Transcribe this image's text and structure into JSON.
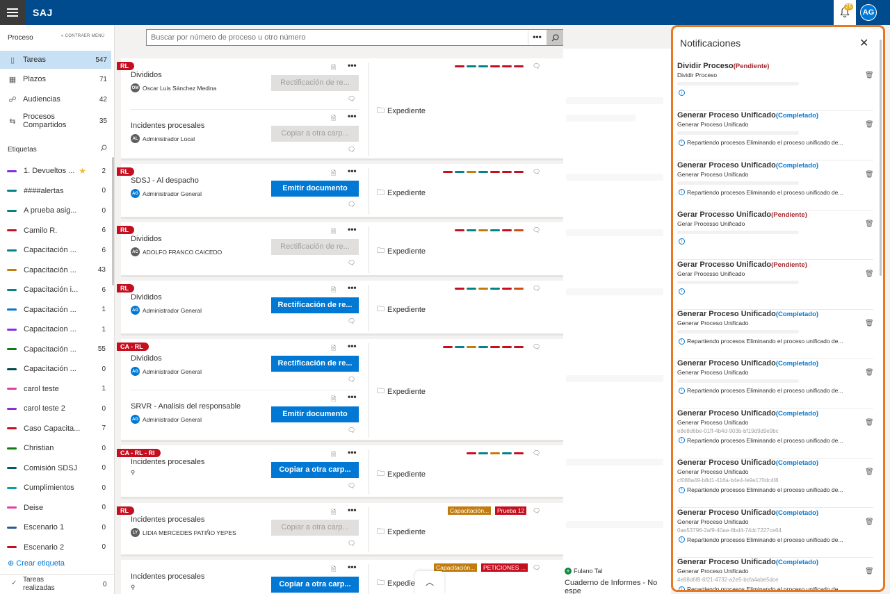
{
  "app": {
    "title": "SAJ",
    "notif_count": "25",
    "user_initials": "AG"
  },
  "sidebar": {
    "heading": "Proceso",
    "collapse": "CONTRAER MENÚ",
    "nav": [
      {
        "label": "Tareas",
        "count": "547",
        "icon": "task-icon"
      },
      {
        "label": "Plazos",
        "count": "71",
        "icon": "calendar-icon"
      },
      {
        "label": "Audiencias",
        "count": "42",
        "icon": "people-icon"
      },
      {
        "label": "Procesos Compartidos",
        "count": "35",
        "icon": "shared-icon"
      }
    ],
    "labels_heading": "Etiquetas",
    "tags": [
      {
        "name": "1. Devueltos ...",
        "count": "2",
        "color": "#8a2be2",
        "star": true
      },
      {
        "name": "####alertas",
        "count": "0",
        "color": "#038387"
      },
      {
        "name": "A prueba asig...",
        "count": "0",
        "color": "#038387"
      },
      {
        "name": "Camilo R.",
        "count": "6",
        "color": "#c50f1f"
      },
      {
        "name": "Capacitación ...",
        "count": "6",
        "color": "#038387"
      },
      {
        "name": "Capacitación ...",
        "count": "43",
        "color": "#c27c0e"
      },
      {
        "name": "Capacitación i...",
        "count": "6",
        "color": "#038387"
      },
      {
        "name": "Capacitación ...",
        "count": "1",
        "color": "#0078d4"
      },
      {
        "name": "Capacitacion ...",
        "count": "1",
        "color": "#8a2be2"
      },
      {
        "name": "Capacitación ...",
        "count": "55",
        "color": "#107c10"
      },
      {
        "name": "Capacitación ...",
        "count": "0",
        "color": "#004b50"
      },
      {
        "name": "carol teste",
        "count": "1",
        "color": "#e43ba6"
      },
      {
        "name": "carol teste 2",
        "count": "0",
        "color": "#8a2be2"
      },
      {
        "name": "Caso Capacita...",
        "count": "7",
        "color": "#c50f1f"
      },
      {
        "name": "Christian",
        "count": "0",
        "color": "#107c10"
      },
      {
        "name": "Comisión SDSJ",
        "count": "0",
        "color": "#005b70"
      },
      {
        "name": "Cumplimientos",
        "count": "0",
        "color": "#00a2ad"
      },
      {
        "name": "Deise",
        "count": "0",
        "color": "#e43ba6"
      },
      {
        "name": "Escenario 1",
        "count": "0",
        "color": "#2b579a"
      },
      {
        "name": "Escenario 2",
        "count": "0",
        "color": "#c50f1f"
      }
    ],
    "create_tag": "Crear etiqueta",
    "done_label": "Tareas realizadas",
    "done_count": "0"
  },
  "search": {
    "placeholder": "Buscar por número de proceso u otro número",
    "more": "•••"
  },
  "cards": [
    {
      "badge": "RL",
      "entries": [
        {
          "title": "Divididos",
          "user": "Oscar Luis Sánchez Medina",
          "ini": "OM",
          "av": "gray",
          "btn": "Rectificación de re...",
          "btn_state": "disabled"
        },
        {
          "title": "Incidentes procesales",
          "user": "Administrador Local",
          "ini": "AL",
          "av": "gray",
          "btn": "Copiar a otra carp...",
          "btn_state": "disabled"
        }
      ],
      "expediente": "Expediente"
    },
    {
      "badge": "RL",
      "entries": [
        {
          "title": "SDSJ - Al despacho",
          "user": "Administrador General",
          "ini": "AG",
          "av": "blue",
          "btn": "Emitir documento",
          "btn_state": "primary"
        }
      ],
      "expediente": "Expediente"
    },
    {
      "badge": "RL",
      "entries": [
        {
          "title": "Divididos",
          "user": "ADOLFO FRANCO CAICEDO",
          "ini": "AC",
          "av": "gray",
          "btn": "Rectificación de re...",
          "btn_state": "disabled"
        }
      ],
      "expediente": "Expediente"
    },
    {
      "badge": "RL",
      "entries": [
        {
          "title": "Divididos",
          "user": "Administrador General",
          "ini": "AG",
          "av": "blue",
          "btn": "Rectificación de re...",
          "btn_state": "primary"
        }
      ],
      "expediente": "Expediente"
    },
    {
      "badge": "CA - RL",
      "entries": [
        {
          "title": "Divididos",
          "user": "Administrador General",
          "ini": "AG",
          "av": "blue",
          "btn": "Rectificación de re...",
          "btn_state": "primary"
        },
        {
          "title": "SRVR - Analisis del responsable",
          "user": "Administrador General",
          "ini": "AG",
          "av": "blue",
          "btn": "Emitir documento",
          "btn_state": "primary"
        }
      ],
      "expediente": "Expediente"
    },
    {
      "badge": "CA - RL - RI",
      "entries": [
        {
          "title": "Incidentes procesales",
          "user": "",
          "ini": "",
          "av": "",
          "btn": "Copiar a otra carp...",
          "btn_state": "primary"
        }
      ],
      "expediente": "Expediente"
    },
    {
      "badge": "RL",
      "entries": [
        {
          "title": "Incidentes procesales",
          "user": "LIDIA MERCEDES PATIÑO YEPES",
          "ini": "LY",
          "av": "gray",
          "btn": "Copiar a otra carp...",
          "btn_state": "disabled"
        }
      ],
      "expediente": "Expediente",
      "chips": [
        {
          "text": "Capacitación...",
          "color": "#c27c0e"
        },
        {
          "text": "Prueba 12",
          "color": "#c50f1f"
        }
      ]
    },
    {
      "badge": "",
      "entries": [
        {
          "title": "Incidentes procesales",
          "user": "",
          "ini": "",
          "av": "",
          "btn": "Copiar a otra carp...",
          "btn_state": "primary"
        }
      ],
      "expediente": "Expediente",
      "chips": [
        {
          "text": "Capacitación...",
          "color": "#c27c0e"
        },
        {
          "text": "PETICIONES ...",
          "color": "#c50f1f"
        }
      ]
    }
  ],
  "bottom_peek": {
    "user": "Fulano Tal",
    "text": "Cuaderno de Informes - No espe"
  },
  "notifications": {
    "title": "Notificaciones",
    "items": [
      {
        "title": "Dividir Proceso",
        "status": "Pendiente",
        "sub": "Dividir Proceso",
        "guid": "",
        "detail": ""
      },
      {
        "title": "Generar Proceso Unificado",
        "status": "Completado",
        "sub": "Generar Proceso Unificado",
        "guid": "",
        "detail": "Repartiendo procesos Eliminando el proceso unificado de..."
      },
      {
        "title": "Generar Proceso Unificado",
        "status": "Completado",
        "sub": "Generar Proceso Unificado",
        "guid": "",
        "detail": "Repartiendo procesos Eliminando el proceso unificado de..."
      },
      {
        "title": "Gerar Processo Unificado",
        "status": "Pendiente",
        "sub": "Gerar Processo Unificado",
        "guid": "",
        "detail": ""
      },
      {
        "title": "Gerar Processo Unificado",
        "status": "Pendiente",
        "sub": "Gerar Processo Unificado",
        "guid": "",
        "detail": ""
      },
      {
        "title": "Generar Proceso Unificado",
        "status": "Completado",
        "sub": "Generar Proceso Unificado",
        "guid": "",
        "detail": "Repartiendo procesos Eliminando el proceso unificado de..."
      },
      {
        "title": "Generar Proceso Unificado",
        "status": "Completado",
        "sub": "Generar Proceso Unificado",
        "guid": "",
        "detail": "Repartiendo procesos Eliminando el proceso unificado de..."
      },
      {
        "title": "Generar Proceso Unificado",
        "status": "Completado",
        "sub": "Generar Proceso Unificado",
        "guid": "e8e8d6be-01ff-4b4d-903b-bf19d9d9e9bc",
        "detail": "Repartiendo procesos Eliminando el proceso unificado de..."
      },
      {
        "title": "Generar Proceso Unificado",
        "status": "Completado",
        "sub": "Generar Proceso Unificado",
        "guid": "cf088a49-b8d1-416a-b4e4-fe9e170dc4f8",
        "detail": "Repartiendo procesos Eliminando el proceso unificado de..."
      },
      {
        "title": "Generar Proceso Unificado",
        "status": "Completado",
        "sub": "Generar Proceso Unificado",
        "guid": "0ae53796-2af9-40ae-8bd4-74dc7227ce64",
        "detail": "Repartiendo procesos Eliminando el proceso unificado de..."
      },
      {
        "title": "Generar Proceso Unificado",
        "status": "Completado",
        "sub": "Generar Proceso Unificado",
        "guid": "4e88d6f8-6f21-4732-a2e5-bcfa4abe5dce",
        "detail": "Repartiendo procesos Eliminando el proceso unificado de..."
      }
    ],
    "status_colors": {
      "Pendiente": "#a4262c",
      "Completado": "#0078d4"
    }
  }
}
